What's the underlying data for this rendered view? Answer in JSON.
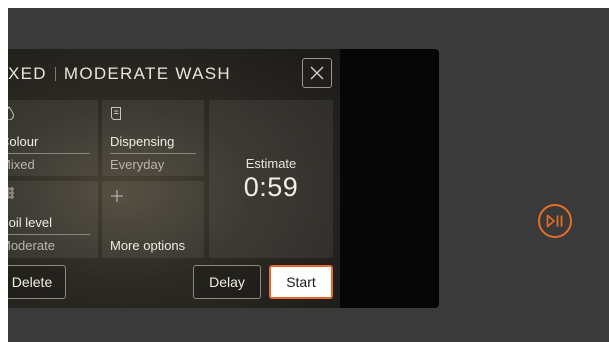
{
  "program": {
    "title_left": "XED",
    "title_right": "MODERATE WASH"
  },
  "tiles": {
    "colour": {
      "label": "Colour",
      "value": "Mixed",
      "icon": "droplet-icon"
    },
    "dispensing": {
      "label": "Dispensing",
      "value": "Everyday",
      "icon": "dispenser-icon"
    },
    "soil": {
      "label": "Soil level",
      "value": "Moderate",
      "icon": "dots-grid-icon"
    },
    "more": {
      "label": "More options",
      "icon": "plus-icon"
    },
    "estimate": {
      "label": "Estimate",
      "value": "0:59"
    }
  },
  "buttons": {
    "delete": "Delete",
    "delay": "Delay",
    "start": "Start"
  },
  "colors": {
    "accent": "#e66e24",
    "background": "#3a3a3a",
    "screen": "#060606"
  }
}
